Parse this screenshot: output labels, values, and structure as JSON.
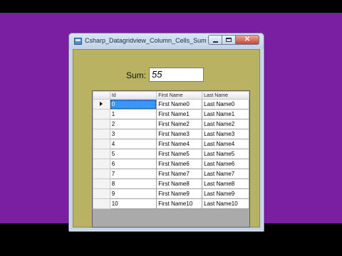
{
  "window": {
    "title": "Csharp_Datagridview_Column_Cells_Sum"
  },
  "sum": {
    "label": "Sum:",
    "value": "55"
  },
  "grid": {
    "columns": [
      "Id",
      "First Name",
      "Last Name"
    ],
    "rows": [
      [
        "0",
        "First Name0",
        "Last Name0"
      ],
      [
        "1",
        "First Name1",
        "Last Name1"
      ],
      [
        "2",
        "First Name2",
        "Last Name2"
      ],
      [
        "3",
        "First Name3",
        "Last Name3"
      ],
      [
        "4",
        "First Name4",
        "Last Name4"
      ],
      [
        "5",
        "First Name5",
        "Last Name5"
      ],
      [
        "6",
        "First Name6",
        "Last Name6"
      ],
      [
        "7",
        "First Name7",
        "Last Name7"
      ],
      [
        "8",
        "First Name8",
        "Last Name8"
      ],
      [
        "9",
        "First Name9",
        "Last Name9"
      ],
      [
        "10",
        "First Name10",
        "Last Name10"
      ]
    ],
    "current_row": 0
  },
  "colors": {
    "background": "#7b1fa2",
    "form_background": "#b8b262",
    "selection": "#3399ff",
    "grid_background": "#aaaaaa"
  },
  "icons": [
    "app-icon",
    "minimize-icon",
    "maximize-icon",
    "close-icon",
    "current-row-arrow-icon"
  ]
}
